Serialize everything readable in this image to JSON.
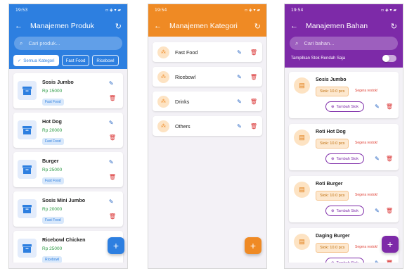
{
  "panel_produk": {
    "status": {
      "time": "19:53",
      "icons": "▫ ◈ ▾ ▰"
    },
    "appbar": {
      "back_icon": "←",
      "title": "Manajemen Produk",
      "refresh_icon": "↻"
    },
    "search": {
      "placeholder": "Cari produk..."
    },
    "chips": [
      "Semua Kategori",
      "Fast Food",
      "Ricebowl"
    ],
    "selected_chip_check": "✓",
    "products": [
      {
        "name": "Sosis Jumbo",
        "price": "Rp 15000",
        "tag": "Fast Food"
      },
      {
        "name": "Hot Dog",
        "price": "Rp 20000",
        "tag": "Fast Food"
      },
      {
        "name": "Burger",
        "price": "Rp 25000",
        "tag": "Fast Food"
      },
      {
        "name": "Sosis Mini Jumbo",
        "price": "Rp 20000",
        "tag": "Fast Food"
      },
      {
        "name": "Ricebowl Chicken",
        "price": "Rp 25000",
        "tag": "Ricebowl"
      }
    ],
    "fab_label": "+"
  },
  "panel_kategori": {
    "status": {
      "time": "19:54",
      "icons": "▫ ◈ ▾ ▰"
    },
    "appbar": {
      "back_icon": "←",
      "title": "Manajemen Kategori",
      "refresh_icon": "↻"
    },
    "categories": [
      "Fast Food",
      "Ricebowl",
      "Drinks",
      "Others"
    ],
    "fab_label": "+"
  },
  "panel_bahan": {
    "status": {
      "time": "19:54",
      "icons": "▫ ◈ ▾ ▰"
    },
    "appbar": {
      "back_icon": "←",
      "title": "Manajemen Bahan",
      "refresh_icon": "↻"
    },
    "search": {
      "placeholder": "Cari bahan..."
    },
    "lowstock_label": "Tampilkan Stok Rendah Saja",
    "lowstock_on": false,
    "ingredients": [
      {
        "name": "Sosis Jumbo",
        "stock": "Stok: 10.0 pcs",
        "warning": "Segera restok!",
        "add_label": "Tambah Stok"
      },
      {
        "name": "Roti Hot Dog",
        "stock": "Stok: 10.0 pcs",
        "warning": "Segera restok!",
        "add_label": "Tambah Stok"
      },
      {
        "name": "Roti Burger",
        "stock": "Stok: 10.0 pcs",
        "warning": "Segera restok!",
        "add_label": "Tambah Stok"
      },
      {
        "name": "Daging Burger",
        "stock": "Stok: 10.0 pcs",
        "warning": "Segera restok!",
        "add_label": "Tambah Stok"
      }
    ],
    "fab_label": "+"
  },
  "colors": {
    "produk": "#2d7fe0",
    "kategori": "#ef8a24",
    "bahan": "#7d2aa8",
    "price_green": "#2e9a45",
    "delete_red": "#d93030"
  }
}
